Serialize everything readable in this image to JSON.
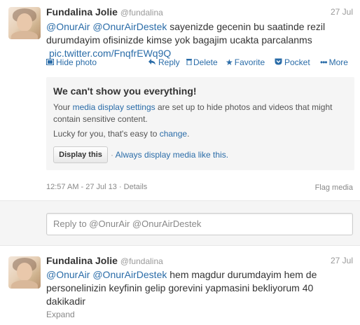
{
  "tweet1": {
    "name": "Fundalina Jolie",
    "handle": "@fundalina",
    "date": "27 Jul",
    "mention1": "@OnurAir",
    "mention2": "@OnurAirDestek",
    "text1": " sayenizde gecenin bu saatinde rezil",
    "text2": "durumdayim ofisinizde kimse yok bagajim ucakta parcalanms",
    "link": "pic.twitter.com/FnqfrEWq9Q",
    "actions": {
      "hide_photo": "Hide photo",
      "reply": "Reply",
      "delete": "Delete",
      "favorite": "Favorite",
      "pocket": "Pocket",
      "more": "More"
    },
    "warning": {
      "title": "We can't show you everything!",
      "line1_pre": "Your ",
      "line1_link": "media display settings",
      "line1_post": " are set up to hide photos and videos that might",
      "line2": "contain sensitive content.",
      "lucky_pre": "Lucky for you, that's easy to ",
      "lucky_link": "change",
      "lucky_post": ".",
      "display_button": "Display this",
      "sep": "·",
      "always_link": "Always display media like this."
    },
    "timestamp": "12:57 AM - 27 Jul 13 · Details",
    "flag_media": "Flag media"
  },
  "reply": {
    "placeholder": "Reply to @OnurAir @OnurAirDestek"
  },
  "tweet2": {
    "name": "Fundalina Jolie",
    "handle": "@fundalina",
    "date": "27 Jul",
    "mention1": "@OnurAir",
    "mention2": "@OnurAirDestek",
    "text1": " hem magdur durumdayim hem de",
    "text2": "personelinizin keyfinin gelip gorevini yapmasini bekliyorum 40",
    "text3": "dakikadir",
    "expand": "Expand"
  },
  "colors": {
    "link": "#2a6ca8",
    "muted": "#999999",
    "panel": "#f5f5f5"
  },
  "icons": {
    "hide_photo": "photo-icon",
    "reply": "reply-arrow-icon",
    "delete": "trash-icon",
    "favorite": "star-icon",
    "pocket": "pocket-icon",
    "more": "dots-icon"
  }
}
